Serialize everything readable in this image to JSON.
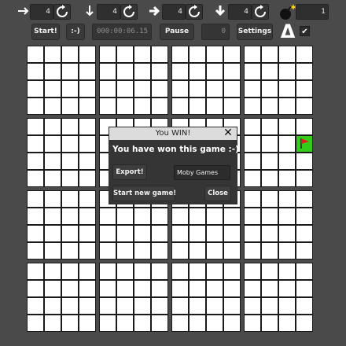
{
  "toolbar": {
    "spinners": [
      {
        "direction": "right-arrow",
        "value": "4",
        "icon": "refresh-icon"
      },
      {
        "direction": "down-arrow",
        "value": "4",
        "icon": "refresh-icon"
      },
      {
        "direction": "right-bold-arrow",
        "value": "4",
        "icon": "refresh-icon"
      },
      {
        "direction": "down-bold-arrow",
        "value": "4",
        "icon": "refresh-icon"
      }
    ],
    "mines": {
      "icon": "bomb-icon",
      "value": "1"
    },
    "start_label": "Start!",
    "smiley_label": ":-)",
    "timer": "000:00:06.15",
    "pause_label": "Pause",
    "score": "0",
    "settings_label": "Settings",
    "delta_symbol": "Δ",
    "check_symbol": "✔"
  },
  "board": {
    "blocks": 4,
    "cells_per_block": 4,
    "flag": {
      "row": 5,
      "col": 15,
      "icon": "red-flag-icon"
    },
    "colors": {
      "cell": "#ffffff",
      "lines": "#1a1a1a",
      "flag_cell": "#33cc1a",
      "flag": "#e01c1c"
    }
  },
  "dialog": {
    "title": "You WIN!",
    "message": "You have won this game :-)",
    "export_label": "Export!",
    "name_value": "Moby Games",
    "new_game_label": "Start new game!",
    "close_label": "Close"
  }
}
